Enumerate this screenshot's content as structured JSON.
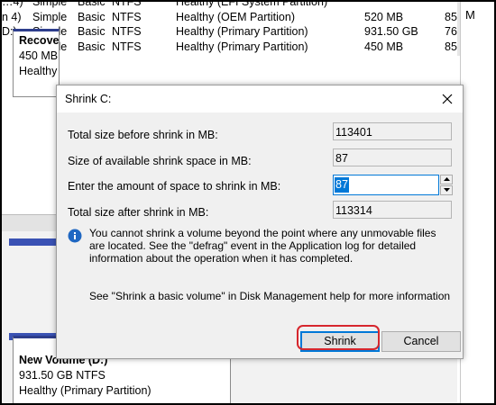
{
  "background": {
    "volumes": [
      {
        "layout": "…4)",
        "type": "Simple",
        "kind": "Basic",
        "fs": "NTFS",
        "status": "Healthy (EFI System Partition)",
        "size": "",
        "free": ""
      },
      {
        "layout": "n 4)",
        "type": "Simple",
        "kind": "Basic",
        "fs": "NTFS",
        "status": "Healthy (OEM Partition)",
        "size": "520 MB",
        "free": "85"
      },
      {
        "layout": "D:)",
        "type": "Simple",
        "kind": "Basic",
        "fs": "NTFS",
        "status": "Healthy (Primary Partition)",
        "size": "931.50 GB",
        "free": "76"
      },
      {
        "layout": "",
        "type": "Simple",
        "kind": "Basic",
        "fs": "NTFS",
        "status": "Healthy (Primary Partition)",
        "size": "450 MB",
        "free": "85"
      }
    ],
    "right_pane_letter": "M",
    "disk_block_1": {
      "name": "Recove",
      "size": "450 MB",
      "status": "Healthy"
    },
    "disk_block_2": {
      "name": "New Volume  (D:)",
      "size": "931.50 GB NTFS",
      "status": "Healthy (Primary Partition)"
    }
  },
  "dialog": {
    "title": "Shrink C:",
    "fields": {
      "total_before_label": "Total size before shrink in MB:",
      "total_before_value": "113401",
      "available_label": "Size of available shrink space in MB:",
      "available_value": "87",
      "amount_label": "Enter the amount of space to shrink in MB:",
      "amount_value": "87",
      "total_after_label": "Total size after shrink in MB:",
      "total_after_value": "113314"
    },
    "info_text": "You cannot shrink a volume beyond the point where any unmovable files are located. See the \"defrag\" event in the Application log for detailed information about the operation when it has completed.",
    "help_text": "See \"Shrink a basic volume\" in Disk Management help for more information",
    "buttons": {
      "shrink": "Shrink",
      "cancel": "Cancel"
    }
  },
  "colors": {
    "accent": "#0078d7",
    "highlight": "#d6262d",
    "info_icon": "#1f67c2"
  }
}
